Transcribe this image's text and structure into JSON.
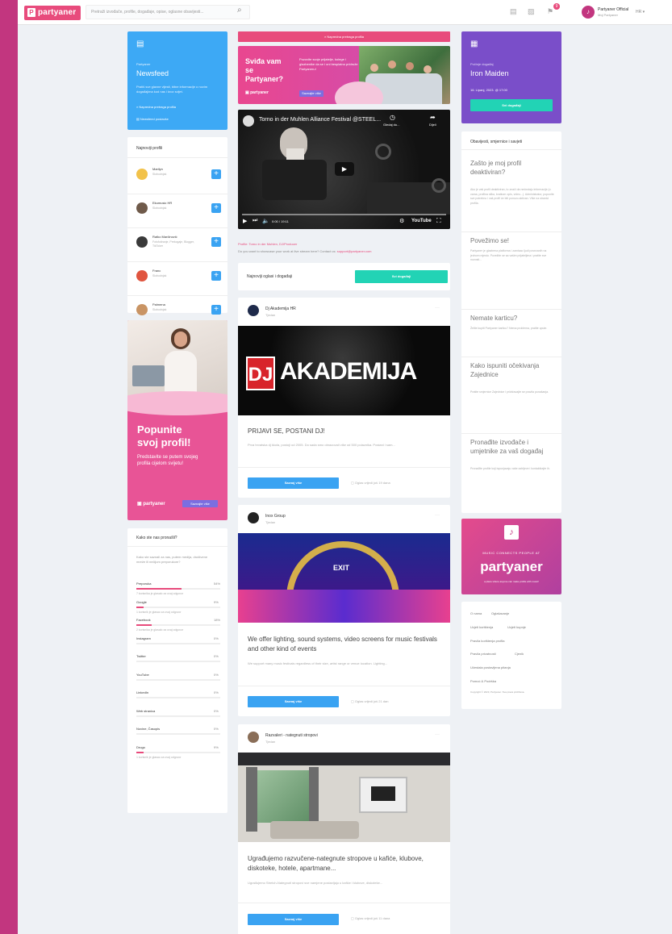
{
  "topbar": {
    "logo": "partyaner",
    "logo_mark": "P",
    "search_placeholder": "Pretraži izvođače, profile, događaje, opise, oglasne obavijesti...",
    "notif_count": "9",
    "user_name": "Partyaner Official",
    "user_status": "Moj Partyaner",
    "lang": "HR ▾"
  },
  "left": {
    "newsfeed": {
      "kicker": "Partyaner",
      "title": "Newsfeed",
      "desc": "Pratiš sve glavne vijesti, bitne informacije o novim događajima kod nas i kroz svijet.",
      "link1": "Napredna pretraga profila",
      "link2": "Newsfeed postavke"
    },
    "profiles": {
      "title": "Najnoviji profili",
      "items": [
        {
          "name": "Marilyn",
          "sub": "Slobodnjak"
        },
        {
          "name": "Ekumusic HR",
          "sub": "Slobodnjak"
        },
        {
          "name": "Ratko Marčinović",
          "sub": "Fotofotiranje, Prekogaje, Blogger, TikToker"
        },
        {
          "name": "Franc",
          "sub": "Slobodnjak"
        },
        {
          "name": "Palmena",
          "sub": "Slobodnjak"
        }
      ]
    },
    "promo": {
      "line1": "Popunite",
      "line2": "svoj profil!",
      "desc": "Predstavite se putem svojeg profila cijelom svijetu!",
      "brand": "partyaner",
      "btn": "Saznajte više"
    },
    "poll": {
      "title": "Kako ste nas pronašli?",
      "desc": "Kako ste saznali za nas, putem medija, društvene mreže ili nečijom preporukom?",
      "items": [
        {
          "label": "Preporuka",
          "pct": "54%",
          "value": 54,
          "note": "7 korisnika je glasalo za ovaj odgovor"
        },
        {
          "label": "Google",
          "pct": "9%",
          "value": 9,
          "note": "1 korisnik je glasao za ovaj odgovor"
        },
        {
          "label": "Facebook",
          "pct": "18%",
          "value": 18,
          "note": "2 korisnika je glasalo za ovaj odgovor"
        },
        {
          "label": "Instagram",
          "pct": "0%",
          "value": 0,
          "note": ""
        },
        {
          "label": "Twitter",
          "pct": "0%",
          "value": 0,
          "note": ""
        },
        {
          "label": "YouTube",
          "pct": "0%",
          "value": 0,
          "note": ""
        },
        {
          "label": "LinkedIn",
          "pct": "0%",
          "value": 0,
          "note": ""
        },
        {
          "label": "Web stranica",
          "pct": "0%",
          "value": 0,
          "note": ""
        },
        {
          "label": "Novine, Časopis",
          "pct": "0%",
          "value": 0,
          "note": ""
        },
        {
          "label": "Drugo",
          "pct": "9%",
          "value": 9,
          "note": "1 korisnik je glasao za ovaj odgovor"
        }
      ]
    }
  },
  "center": {
    "search_btn": "Napredna pretraga profila",
    "banner": {
      "title": "Sviđa vam se Partyaner?",
      "desc": "Pozovite svoje prijatelje, kolege i glazbenike da se i oni besplatno pridruže Partyaneru!",
      "btn": "Saznajte više",
      "brand": "partyaner"
    },
    "video": {
      "title": "Torno in der Muhlen Alliance Festival @STEEL...",
      "watch": "Gledaj du...",
      "share": "Dijeli",
      "time": "0:00 / 19:11",
      "yt": "YouTube"
    },
    "profile_line": "Profile: Torno in der Muhlen, DJ/Producer",
    "showcase_pre": "Do you want to showcase your work at live stream here? Contact us:",
    "showcase_email": "support@partyaner.com",
    "ads": {
      "title": "Najnoviji oglasi i događaji",
      "btn": "Svi događaji"
    },
    "posts": [
      {
        "author": "Dj Akademija HR",
        "time": "Tjedan",
        "img_text": "AKADEMIJA",
        "img_badge": "DJ",
        "heading": "PRIJAVI SE, POSTANI DJ!",
        "text": "Prva hrvatska dj škola, postoji od 2005. Do sada smo obrazovali više od 500 polaznika. Postani i sam...",
        "btn": "Saznaj više",
        "meta": "Oglas vrijedi još 19 dana"
      },
      {
        "author": "Inox Group",
        "time": "Tjedan",
        "img_text": "EXIT",
        "heading": "We offer lighting, sound systems, video screens for music festivals and other kind of events",
        "text": "We support many music festivals regardless of their size, artist range or venue location. Lighting...",
        "btn": "Saznaj više",
        "meta": "Oglas vrijedi još 21 dan"
      },
      {
        "author": "Razvaleri - nategnuti stropovi",
        "time": "Tjedan",
        "heading": "Ugrađujemo razvučene-nategnute stropove u kafiće, klubove, diskoteke, hotele, apartmane...",
        "text": "Ugrađujemo Stretch-Nategnuti stropovi sve namjene postavljaju u kafiće i klubove, diskoteke...",
        "btn": "Saznaj više",
        "meta": "Oglas vrijedi još 11 dana"
      }
    ]
  },
  "right": {
    "event": {
      "kicker": "Počinje događaj",
      "title": "Iron Maiden",
      "date": "16. Lipanj, 2023. @ 17:00",
      "btn": "Svi događaji"
    },
    "faq": {
      "title": "Obavijesti, smjernice i savjeti",
      "items": [
        {
          "q": "Zašto je moj profil deaktiviran?",
          "a": "Ako je vaš profil deaktiviran, to znači da nedostaju informacije (o vama, profilna slika, kratkom opis, video...). Administrator, popunite sve potrebno i vaš profil će biti ponovo aktivan. Više na stranici profila."
        },
        {
          "q": "Povežimo se!",
          "a": "Partyaner je glazbena platforma i zamisao ljudi povezanih na jednom mjestu. Povežite se sa vašim prijateljima i pratite sve novosti..."
        },
        {
          "q": "Nemate karticu?",
          "a": "Želite kupiti Partyaner karticu? Nema problema, pratite upute."
        },
        {
          "q": "Kako ispuniti očekivanja Zajednice",
          "a": "Pratite smjernice Zajednice i pridržavajte se pravila ponašanja."
        },
        {
          "q": "Pronađite izvođače i umjetnike za vaš događaj",
          "a": "Pronađite profile koji ispunjavaju vaše zahtjeve i kontaktirajte ih."
        }
      ]
    },
    "ad": {
      "tagline": "MUSIC CONNECTS PEOPLE AT",
      "brand": "partyaner",
      "sub": "a place where anyone can make profile with music!"
    },
    "footer": {
      "links": [
        "O nama",
        "Oglašavanje",
        "Uvjeti korištenja",
        "Uvjeti kupnje",
        "Pravila korištenja profila",
        "Pravila privatnosti",
        "Cjenik",
        "Učestala postavljena pitanja",
        "Pomoć & Podrška"
      ],
      "copyright": "Copyright © 2023, Partyaner. Sva prava pridržana."
    }
  }
}
